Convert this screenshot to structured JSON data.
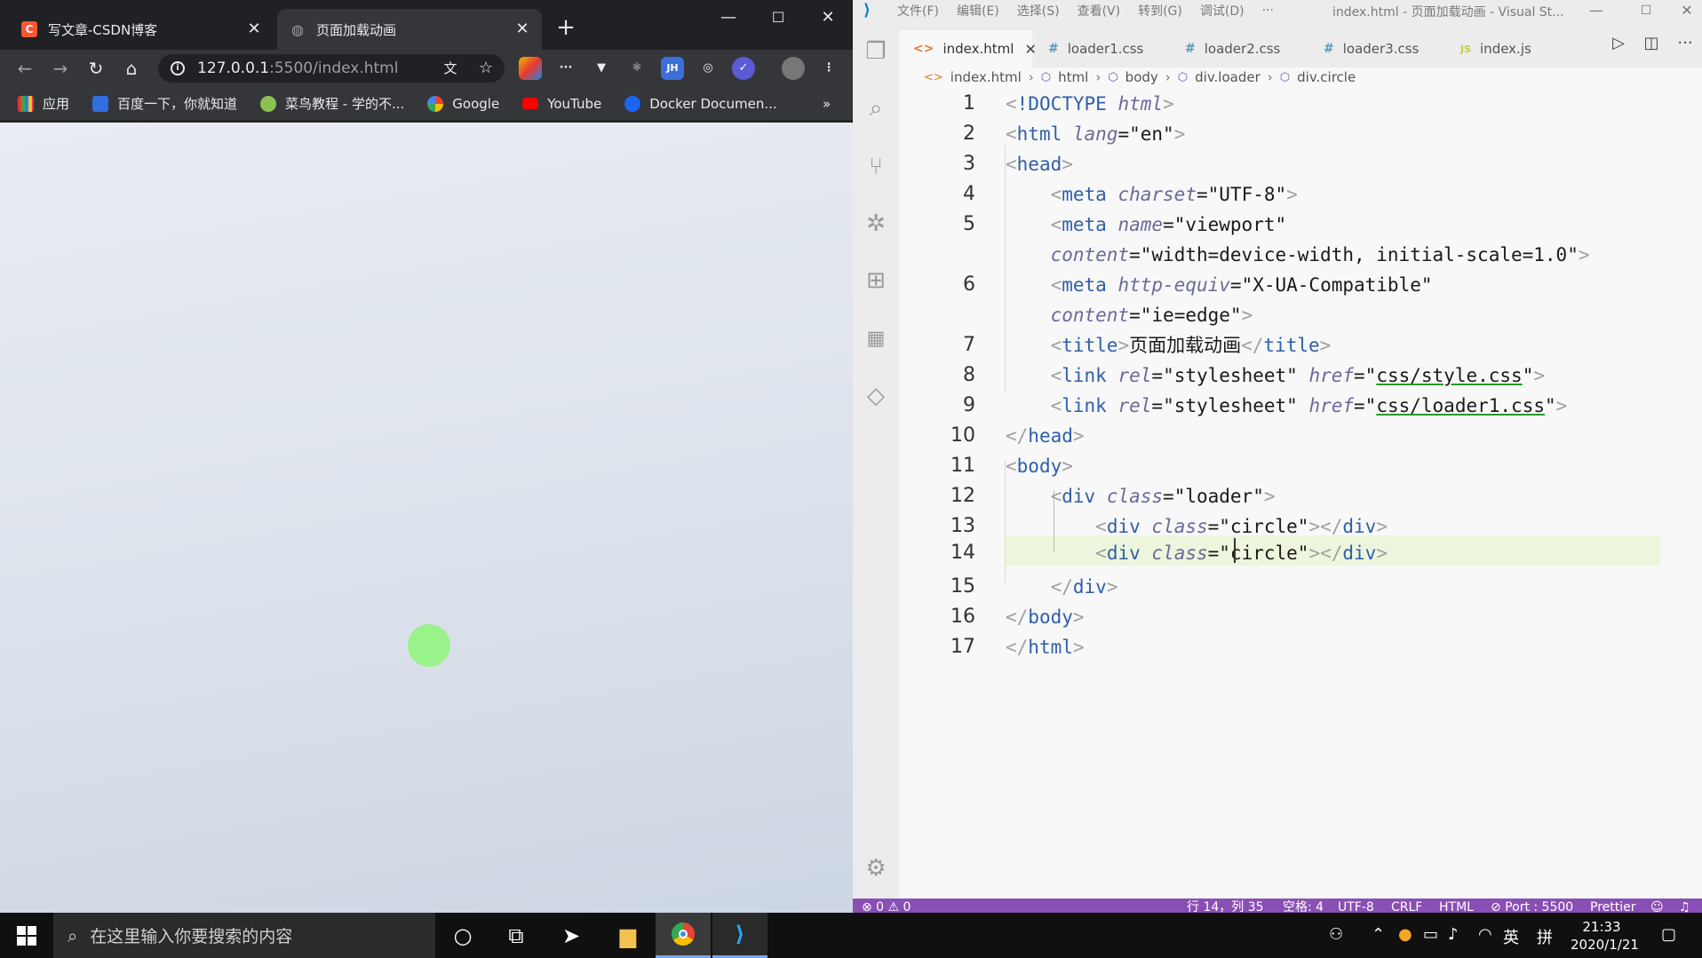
{
  "chrome": {
    "tabs": [
      {
        "title": "写文章-CSDN博客",
        "icon": "csdn-icon",
        "close": "✕"
      },
      {
        "title": "页面加载动画",
        "icon": "globe-icon",
        "close": "✕"
      }
    ],
    "new_tab": "+",
    "address": {
      "host": "127.0.0.1",
      "path": ":5500/index.html"
    },
    "bookmarks": [
      {
        "label": "应用",
        "icon": "apps-icon"
      },
      {
        "label": "百度一下，你就知道",
        "icon": "baidu-icon"
      },
      {
        "label": "菜鸟教程 - 学的不...",
        "icon": "runoob-icon"
      },
      {
        "label": "Google",
        "icon": "google-icon"
      },
      {
        "label": "YouTube",
        "icon": "youtube-icon"
      },
      {
        "label": "Docker Documen...",
        "icon": "docker-icon"
      }
    ],
    "bookmarks_more": "»",
    "page": {
      "loader_color": "#99f28a"
    }
  },
  "vscode": {
    "menu": [
      "文件(F)",
      "编辑(E)",
      "选择(S)",
      "查看(V)",
      "转到(G)",
      "调试(D)",
      "···"
    ],
    "window_title": "index.html - 页面加载动画 - Visual St...",
    "editor_tabs": [
      {
        "label": "index.html",
        "icon": "<>",
        "active": true
      },
      {
        "label": "loader1.css",
        "icon": "#"
      },
      {
        "label": "loader2.css",
        "icon": "#"
      },
      {
        "label": "loader3.css",
        "icon": "#"
      },
      {
        "label": "index.js",
        "icon": "JS"
      }
    ],
    "breadcrumb": [
      "index.html",
      "html",
      "body",
      "div.loader",
      "div.circle"
    ],
    "status": {
      "problems": "⊗ 0 ⚠ 0",
      "position": "行 14，列 35",
      "spaces": "空格: 4",
      "encoding": "UTF-8",
      "eol": "CRLF",
      "language": "HTML",
      "port": "⊘ Port : 5500",
      "formatter": "Prettier",
      "accent": "#8a4fb5"
    },
    "code_text": {
      "title_text": "页面加载动画",
      "href1": "css/style.css",
      "href2": "css/loader1.css",
      "viewport_content": "width=device-width, initial-scale=1.0",
      "ie_content": "ie=edge"
    }
  },
  "taskbar": {
    "search_placeholder": "在这里输入你要搜索的内容",
    "ime": "英",
    "ime2": "拼",
    "time": "21:33",
    "date": "2020/1/21"
  }
}
